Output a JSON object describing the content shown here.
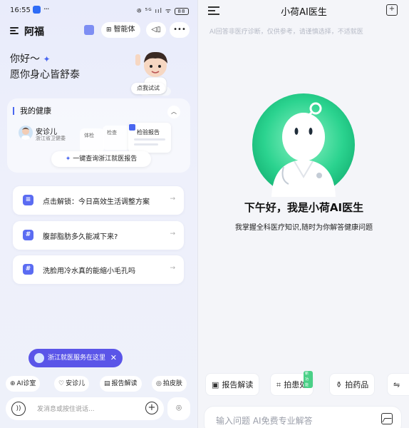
{
  "status": {
    "time": "16:55",
    "ellipsis": "···",
    "icons": "ꔮ ⁵ᴳ ııl ᯤ",
    "battery": "88"
  },
  "left": {
    "title": "阿福",
    "agent_label": "智能体",
    "greeting": "你好～",
    "wish": "愿你身心皆舒泰",
    "try_label": "点我试试",
    "health_card": {
      "title": "我的健康",
      "patient_name": "安诊儿",
      "patient_org": "浙江省卫健委",
      "report_small_1": "体检",
      "report_small_2": "检查",
      "report_main": "检验报告",
      "query_label": "一键查询浙江就医报告"
    },
    "suggestions": [
      {
        "icon": "≡",
        "text": "点击解锁：今日高效生活调整方案"
      },
      {
        "icon": "#",
        "text": "腹部脂肪多久能减下来?"
      },
      {
        "icon": "#",
        "text": "洗脸用冷水真的能缩小毛孔吗"
      }
    ],
    "zj_pill": "浙江就医服务在这里",
    "quick_buttons": [
      "AI诊室",
      "安诊儿",
      "报告解读",
      "拍皮肤"
    ],
    "input_placeholder": "发消息或按住说话..."
  },
  "right": {
    "title": "小荷AI医生",
    "disclaimer": "AI回答非医疗诊断，仅供参考，请谨慎选择，不适就医",
    "greeting": "下午好，我是小荷AI医生",
    "subtitle": "我掌握全科医疗知识,随时为你解答健康问题",
    "quick_buttons": [
      "报告解读",
      "拍患处",
      "拍药品"
    ],
    "new_tag": "新功能",
    "input_placeholder": "输入问题 AI免费专业解答"
  },
  "colors": {
    "accent": "#5b6cf2",
    "robot_green": "#2bd38f",
    "pill": "#5a55e8"
  }
}
